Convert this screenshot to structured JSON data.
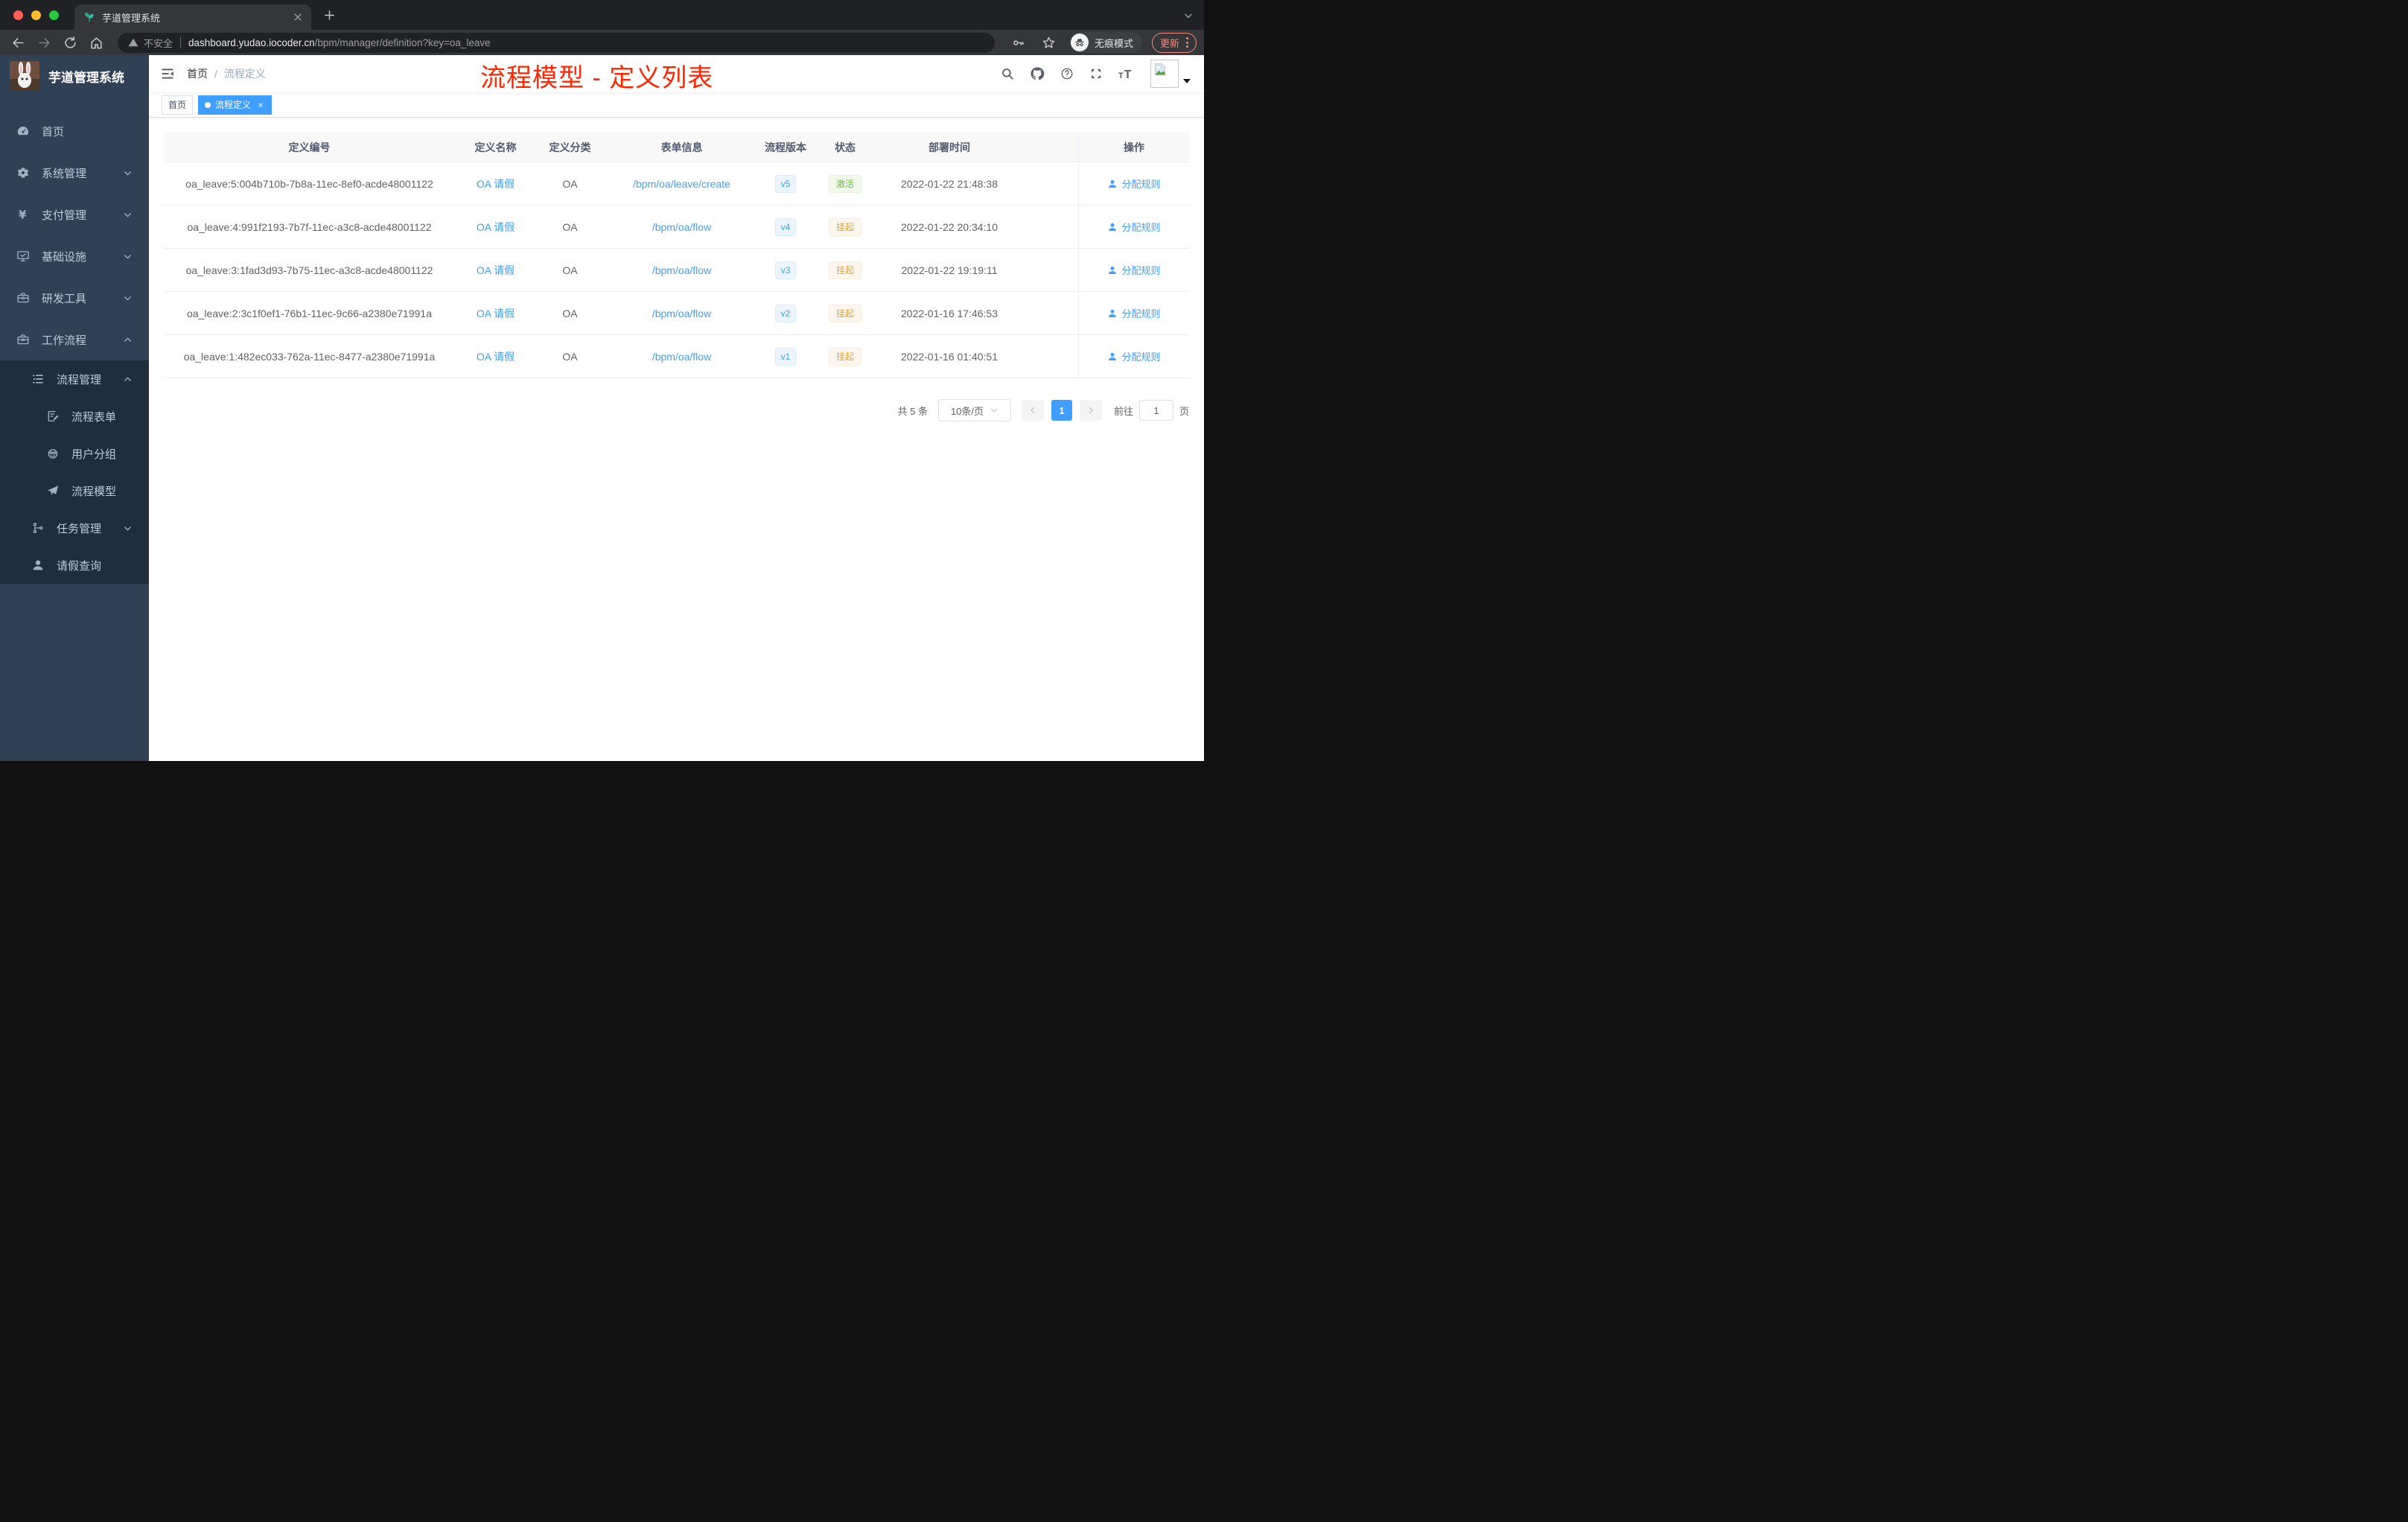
{
  "colors": {
    "accent": "#409eff",
    "success": "#67c23a",
    "warning": "#e6a23c",
    "annotation_red": "#ff2600",
    "sidebar_bg": "#304156",
    "submenu_bg": "#1f2d3d"
  },
  "browser": {
    "tab_title": "芋道管理系统",
    "security_label": "不安全",
    "url_host": "dashboard.yudao.iocoder.cn",
    "url_path": "/bpm/manager/definition?key=oa_leave",
    "incognito_label": "无痕模式",
    "update_label": "更新"
  },
  "sidebar": {
    "logo_title": "芋道管理系统",
    "items": [
      {
        "label": "首页",
        "icon": "dashboard",
        "level": 1,
        "arrow": null
      },
      {
        "label": "系统管理",
        "icon": "gear",
        "level": 1,
        "arrow": "down"
      },
      {
        "label": "支付管理",
        "icon": "yen",
        "level": 1,
        "arrow": "down"
      },
      {
        "label": "基础设施",
        "icon": "monitor",
        "level": 1,
        "arrow": "down"
      },
      {
        "label": "研发工具",
        "icon": "toolbox",
        "level": 1,
        "arrow": "down"
      },
      {
        "label": "工作流程",
        "icon": "toolbox",
        "level": 1,
        "arrow": "up"
      },
      {
        "label": "流程管理",
        "icon": "list",
        "level": 2,
        "arrow": "up"
      },
      {
        "label": "流程表单",
        "icon": "form",
        "level": 3,
        "arrow": null
      },
      {
        "label": "用户分组",
        "icon": "robot",
        "level": 3,
        "arrow": null
      },
      {
        "label": "流程模型",
        "icon": "plane",
        "level": 3,
        "arrow": null
      },
      {
        "label": "任务管理",
        "icon": "tree",
        "level": 2,
        "arrow": "down"
      },
      {
        "label": "请假查询",
        "icon": "user",
        "level": 2,
        "arrow": null
      }
    ]
  },
  "navbar": {
    "breadcrumb": {
      "home": "首页",
      "separator": "/",
      "current": "流程定义"
    },
    "annotation": "流程模型 - 定义列表"
  },
  "tags": [
    {
      "label": "首页",
      "active": false
    },
    {
      "label": "流程定义",
      "active": true
    }
  ],
  "table": {
    "columns": [
      "定义编号",
      "定义名称",
      "定义分类",
      "表单信息",
      "流程版本",
      "状态",
      "部署时间",
      "操作"
    ],
    "rows": [
      {
        "id": "oa_leave:5:004b710b-7b8a-11ec-8ef0-acde48001122",
        "name": "OA 请假",
        "category": "OA",
        "form": "/bpm/oa/leave/create",
        "version": "v5",
        "status": "激活",
        "status_type": "success",
        "deploy_time": "2022-01-22 21:48:38",
        "action": "分配规则"
      },
      {
        "id": "oa_leave:4:991f2193-7b7f-11ec-a3c8-acde48001122",
        "name": "OA 请假",
        "category": "OA",
        "form": "/bpm/oa/flow",
        "version": "v4",
        "status": "挂起",
        "status_type": "warning",
        "deploy_time": "2022-01-22 20:34:10",
        "action": "分配规则"
      },
      {
        "id": "oa_leave:3:1fad3d93-7b75-11ec-a3c8-acde48001122",
        "name": "OA 请假",
        "category": "OA",
        "form": "/bpm/oa/flow",
        "version": "v3",
        "status": "挂起",
        "status_type": "warning",
        "deploy_time": "2022-01-22 19:19:11",
        "action": "分配规则"
      },
      {
        "id": "oa_leave:2:3c1f0ef1-76b1-11ec-9c66-a2380e71991a",
        "name": "OA 请假",
        "category": "OA",
        "form": "/bpm/oa/flow",
        "version": "v2",
        "status": "挂起",
        "status_type": "warning",
        "deploy_time": "2022-01-16 17:46:53",
        "action": "分配规则"
      },
      {
        "id": "oa_leave:1:482ec033-762a-11ec-8477-a2380e71991a",
        "name": "OA 请假",
        "category": "OA",
        "form": "/bpm/oa/flow",
        "version": "v1",
        "status": "挂起",
        "status_type": "warning",
        "deploy_time": "2022-01-16 01:40:51",
        "action": "分配规则"
      }
    ]
  },
  "pagination": {
    "total": "共 5 条",
    "page_size": "10条/页",
    "current_page": "1",
    "goto_label": "前往",
    "goto_value": "1",
    "page_unit": "页"
  }
}
